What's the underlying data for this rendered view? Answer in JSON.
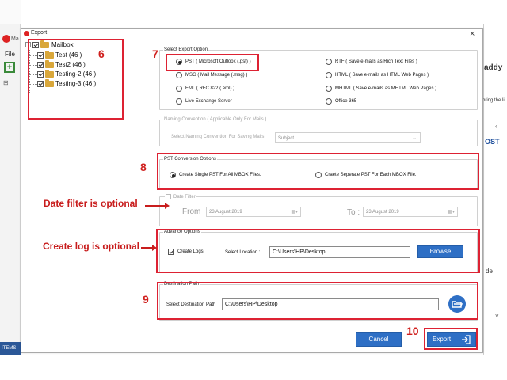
{
  "background": {
    "tab_fragment": "Ma",
    "menu_file": "File",
    "right_fragment_1": "addy",
    "right_fragment_2": "pring the li",
    "right_fragment_3": "OST",
    "right_fragment_4": "de",
    "status_items": "ITEMS"
  },
  "dialog": {
    "title": "Export",
    "close_label": "×"
  },
  "tree": {
    "root_label": "Mailbox",
    "expand_symbol": "−",
    "items": [
      {
        "label": "Test (46 )"
      },
      {
        "label": "Test2 (46 )"
      },
      {
        "label": "Testing-2 (46 )"
      },
      {
        "label": "Testing-3 (46 )"
      }
    ]
  },
  "export_options": {
    "label": "Select Export Option",
    "left": [
      {
        "label": "PST ( Microsoft Outlook (.pst) )",
        "selected": true
      },
      {
        "label": "MSG ( Mail Message (.msg) )",
        "selected": false
      },
      {
        "label": "EML ( RFC 822 (.eml) )",
        "selected": false
      },
      {
        "label": "Live Exchange Server",
        "selected": false
      }
    ],
    "right": [
      {
        "label": "RTF ( Save e-mails as Rich Text Files )",
        "selected": false
      },
      {
        "label": "HTML ( Save e-mails as HTML Web Pages )",
        "selected": false
      },
      {
        "label": "MHTML ( Save e-mails as MHTML Web Pages )",
        "selected": false
      },
      {
        "label": "Office 365",
        "selected": false
      }
    ]
  },
  "naming": {
    "label": "Naming Convention ( Applicable Only For Mails )",
    "field_label": "Select Naming Convention For Saving Mails",
    "value": "Subject"
  },
  "pst_conversion": {
    "label": "PST Conversion Options",
    "single": "Create Single PST For All MBOX Files.",
    "separate": "Craete Seperate PST For Each MBOX File."
  },
  "date_filter": {
    "label": "Date Filter",
    "from_label": "From :",
    "from_value": "23 August 2019",
    "to_label": "To :",
    "to_value": "23 August 2019"
  },
  "advance": {
    "label": "Advance Options",
    "create_logs": "Create Logs",
    "location_label": "Select Location :",
    "location_value": "C:\\Users\\HP\\Desktop",
    "browse_label": "Browse"
  },
  "destination": {
    "label": "Destination Path",
    "field_label": "Select Destination Path",
    "value": "C:\\Users\\HP\\Desktop"
  },
  "buttons": {
    "cancel": "Cancel",
    "export": "Export"
  },
  "annotations": {
    "n6": "6",
    "n7": "7",
    "n8": "8",
    "n9": "9",
    "n10": "10",
    "date_optional": "Date filter is optional",
    "log_optional": "Create log is optional"
  },
  "colors": {
    "accent": "#2e6fc5",
    "annotation": "#d0201e"
  }
}
